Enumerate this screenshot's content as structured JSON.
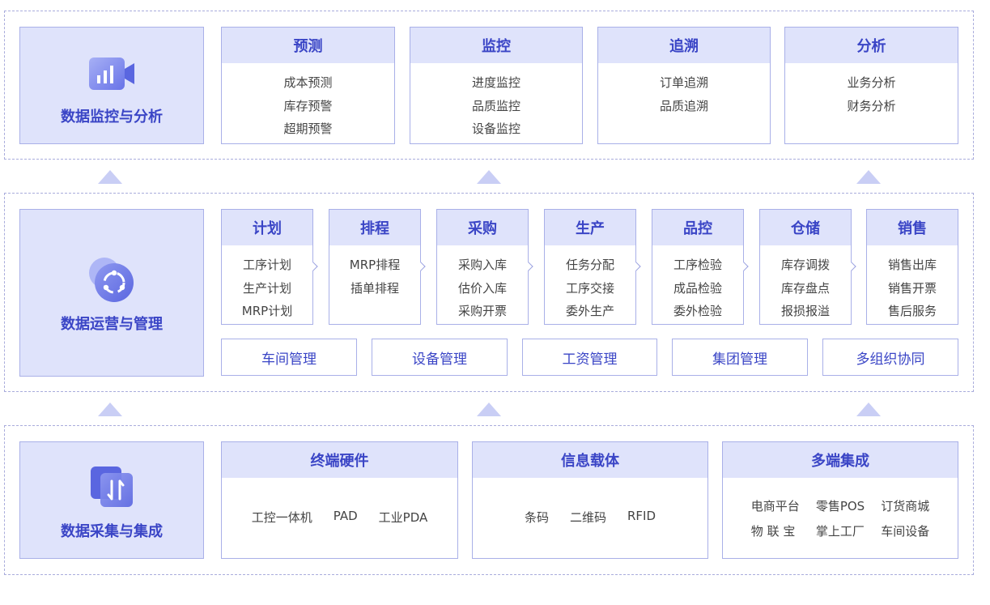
{
  "top": {
    "title": "数据监控与分析",
    "icon": "video-chart-icon",
    "cards": [
      {
        "title": "预测",
        "items": [
          "成本预测",
          "库存预警",
          "超期预警"
        ]
      },
      {
        "title": "监控",
        "items": [
          "进度监控",
          "品质监控",
          "设备监控"
        ]
      },
      {
        "title": "追溯",
        "items": [
          "订单追溯",
          "品质追溯"
        ]
      },
      {
        "title": "分析",
        "items": [
          "业务分析",
          "财务分析"
        ]
      }
    ]
  },
  "middle": {
    "title": "数据运营与管理",
    "icon": "share-network-icon",
    "cards": [
      {
        "title": "计划",
        "items": [
          "工序计划",
          "生产计划",
          "MRP计划"
        ]
      },
      {
        "title": "排程",
        "items": [
          "MRP排程",
          "插单排程"
        ]
      },
      {
        "title": "采购",
        "items": [
          "采购入库",
          "估价入库",
          "采购开票"
        ]
      },
      {
        "title": "生产",
        "items": [
          "任务分配",
          "工序交接",
          "委外生产"
        ]
      },
      {
        "title": "品控",
        "items": [
          "工序检验",
          "成品检验",
          "委外检验"
        ]
      },
      {
        "title": "仓储",
        "items": [
          "库存调拨",
          "库存盘点",
          "报损报溢"
        ]
      },
      {
        "title": "销售",
        "items": [
          "销售出库",
          "销售开票",
          "售后服务"
        ]
      }
    ],
    "management": [
      "车间管理",
      "设备管理",
      "工资管理",
      "集团管理",
      "多组织协同"
    ]
  },
  "bottom": {
    "title": "数据采集与集成",
    "icon": "sync-arrows-icon",
    "cards": [
      {
        "title": "终端硬件",
        "items": [
          "工控一体机",
          "PAD",
          "工业PDA"
        ]
      },
      {
        "title": "信息载体",
        "items": [
          "条码",
          "二维码",
          "RFID"
        ]
      },
      {
        "title": "多端集成",
        "items": [
          "电商平台",
          "零售POS",
          "订货商城",
          "物 联 宝",
          "掌上工厂",
          "车间设备"
        ]
      }
    ]
  },
  "colors": {
    "accent": "#3a45c6",
    "panel": "#dfe3fb",
    "border": "#a9b0e8"
  }
}
